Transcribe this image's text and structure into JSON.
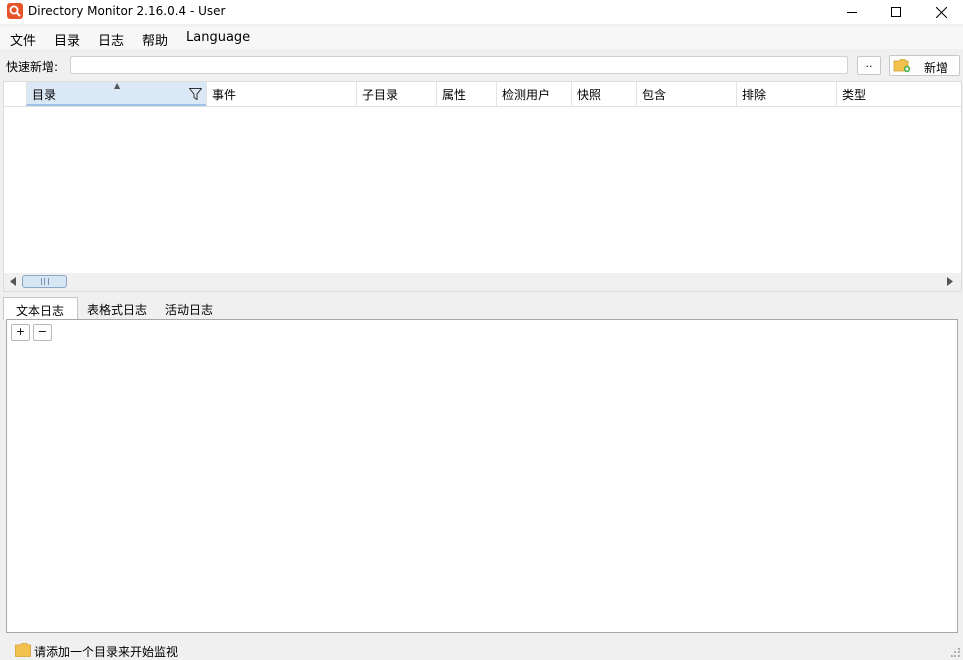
{
  "window": {
    "title": "Directory Monitor 2.16.0.4 - User",
    "icon": "app-search-icon",
    "controls": [
      "minimize-icon",
      "maximize-icon",
      "close-icon"
    ]
  },
  "menu": {
    "items": [
      {
        "label": "文件"
      },
      {
        "label": "目录"
      },
      {
        "label": "日志"
      },
      {
        "label": "帮助"
      },
      {
        "label": "Language"
      }
    ]
  },
  "quick_add": {
    "label": "快速新增:",
    "value": "",
    "browse_label": "..",
    "add_label": "新增",
    "add_icon": "new-folder-icon"
  },
  "grid": {
    "columns": [
      {
        "label": "目录",
        "sorted": true,
        "filter_icon": "filter-icon"
      },
      {
        "label": "事件"
      },
      {
        "label": "子目录"
      },
      {
        "label": "属性"
      },
      {
        "label": "检测用户"
      },
      {
        "label": "快照"
      },
      {
        "label": "包含"
      },
      {
        "label": "排除"
      },
      {
        "label": "类型"
      }
    ],
    "rows": []
  },
  "tabs": [
    {
      "label": "文本日志",
      "active": true
    },
    {
      "label": "表格式日志"
    },
    {
      "label": "活动日志"
    }
  ],
  "log": {
    "expand_label": "+",
    "collapse_label": "−"
  },
  "status": {
    "text": "请添加一个目录来开始监视",
    "icon": "folder-icon"
  },
  "colors": {
    "app_icon": "#e8532a",
    "sorted_header": "#dbe8f6",
    "folder": "#f2c14e"
  }
}
